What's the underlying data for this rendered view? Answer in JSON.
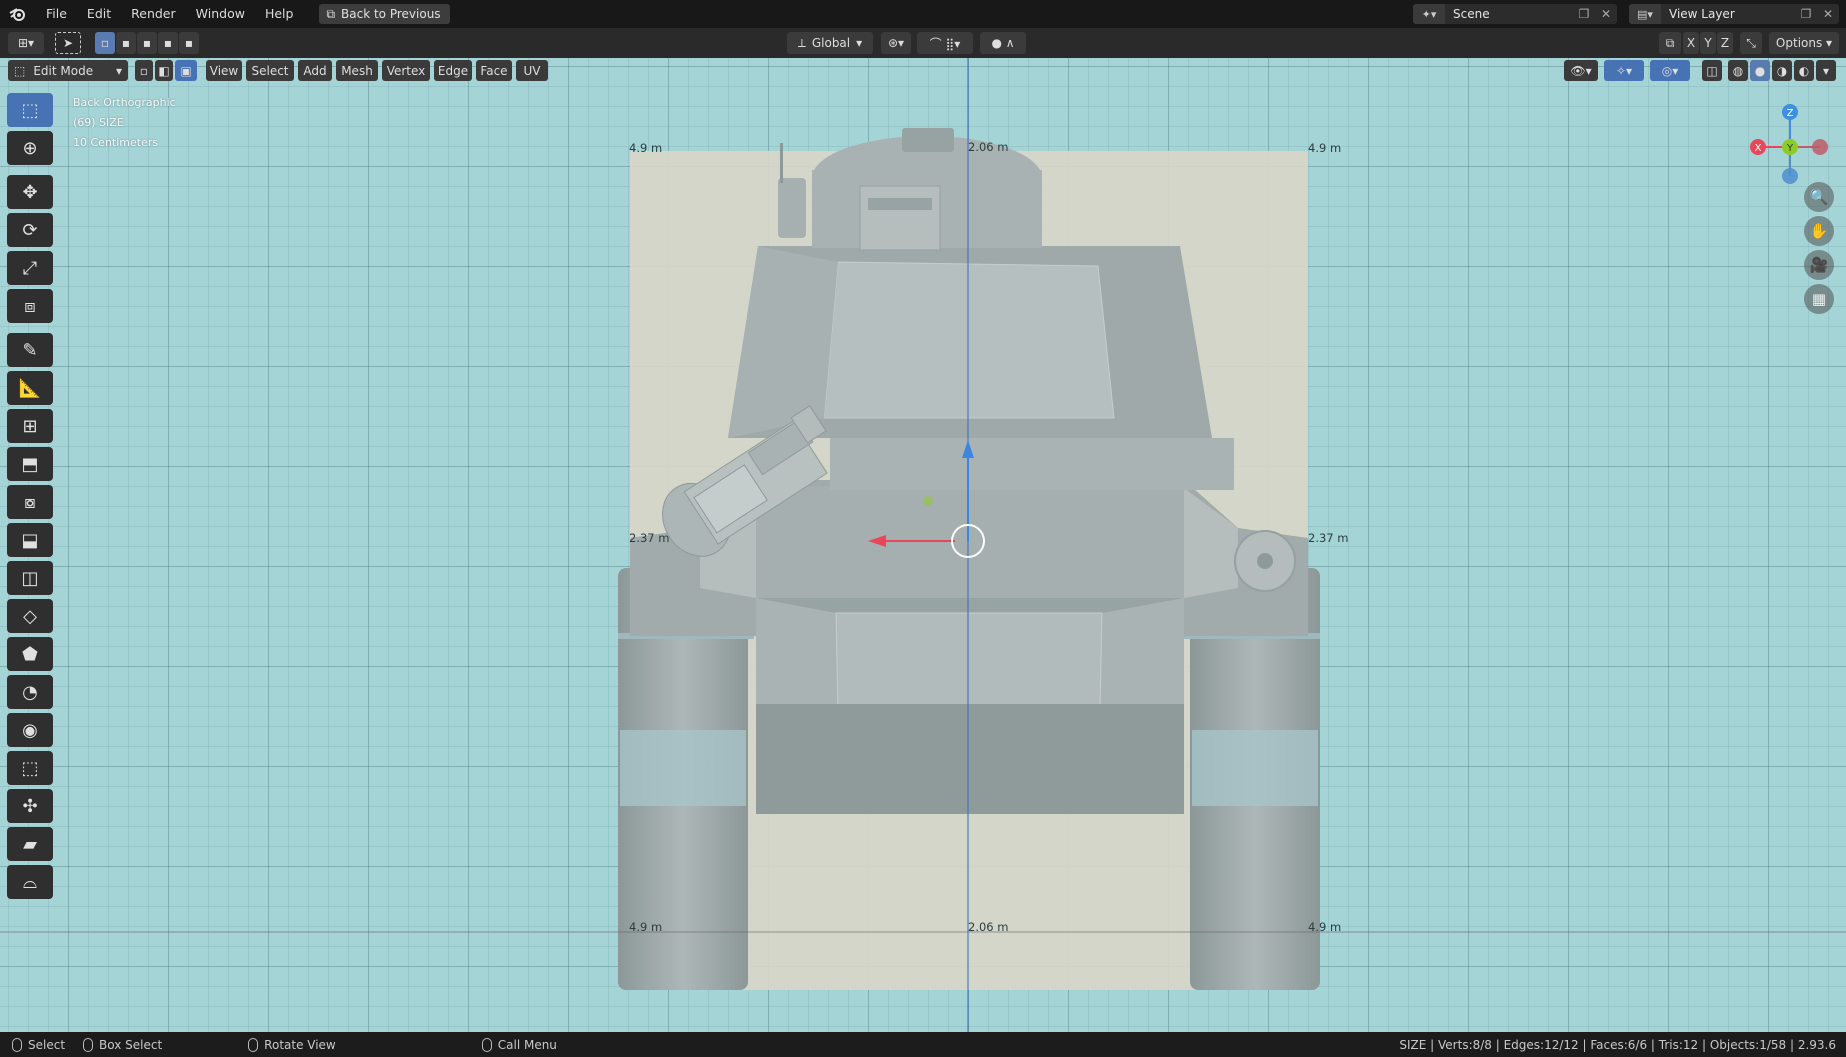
{
  "menubar": {
    "logo_icon": "blender-logo-icon",
    "items": [
      "File",
      "Edit",
      "Render",
      "Window",
      "Help"
    ],
    "back_button": "Back to Previous",
    "scene_name": "Scene",
    "view_layer_name": "View Layer"
  },
  "header": {
    "transform_orientation": "Global",
    "axes": [
      "X",
      "Y",
      "Z"
    ],
    "options_label": "Options"
  },
  "viewport_header": {
    "mode": "Edit Mode",
    "menus": [
      "View",
      "Select",
      "Add",
      "Mesh",
      "Vertex",
      "Edge",
      "Face",
      "UV"
    ]
  },
  "overlay": {
    "view_name": "Back Orthographic",
    "object_info": "(69) SIZE",
    "grid_scale": "10 Centimeters"
  },
  "dimensions": {
    "top_left": "4.9 m",
    "top_center": "2.06 m",
    "top_right": "4.9 m",
    "mid_left": "2.37 m",
    "mid_right": "2.37 m",
    "bottom_left": "4.9 m",
    "bottom_center": "2.06 m",
    "bottom_right": "4.9 m"
  },
  "gizmo": {
    "z": "Z",
    "x": "X",
    "y": "Y"
  },
  "statusbar": {
    "select": "Select",
    "box_select": "Box Select",
    "rotate_view": "Rotate View",
    "call_menu": "Call Menu",
    "stats": "SIZE | Verts:8/8 | Edges:12/12 | Faces:6/6 | Tris:12 | Objects:1/58 | 2.93.6"
  },
  "colors": {
    "viewport_bg": "#a5d4d7",
    "accent": "#4772b3",
    "axis_x": "#e8475a",
    "axis_y": "#8ccc2a",
    "axis_z": "#3f8fe0",
    "reference_plane": "#d8d6c8",
    "tank_body": "#a8b2b1"
  }
}
